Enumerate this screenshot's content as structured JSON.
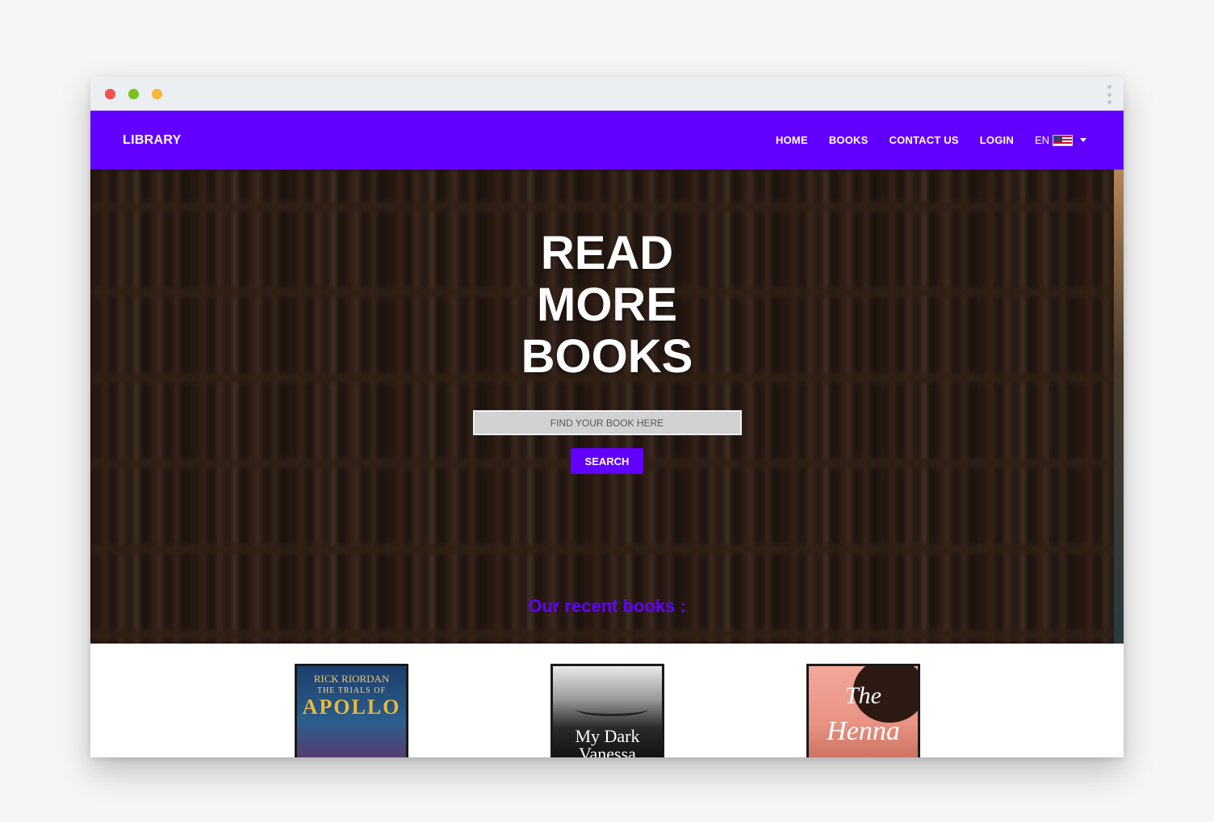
{
  "navbar": {
    "brand": "LIBRARY",
    "links": [
      {
        "label": "HOME"
      },
      {
        "label": "BOOKS"
      },
      {
        "label": "CONTACT US"
      },
      {
        "label": "LOGIN"
      }
    ],
    "language": {
      "code": "EN",
      "flag": "us-flag-icon"
    }
  },
  "hero": {
    "title_lines": [
      "READ",
      "MORE",
      "BOOKS"
    ],
    "search": {
      "placeholder": "FIND YOUR BOOK HERE",
      "value": ""
    },
    "search_button": "SEARCH",
    "recent_heading": "Our recent books :"
  },
  "books": [
    {
      "author": "RICK RIORDAN",
      "series": "THE TRIALS OF",
      "title": "APOLLO"
    },
    {
      "title_line1": "My Dark",
      "title_line2": "Vanessa"
    },
    {
      "title_line1": "The",
      "title_line2": "Henna"
    }
  ],
  "colors": {
    "primary": "#6200ff",
    "window_chrome": "#eceff1"
  }
}
